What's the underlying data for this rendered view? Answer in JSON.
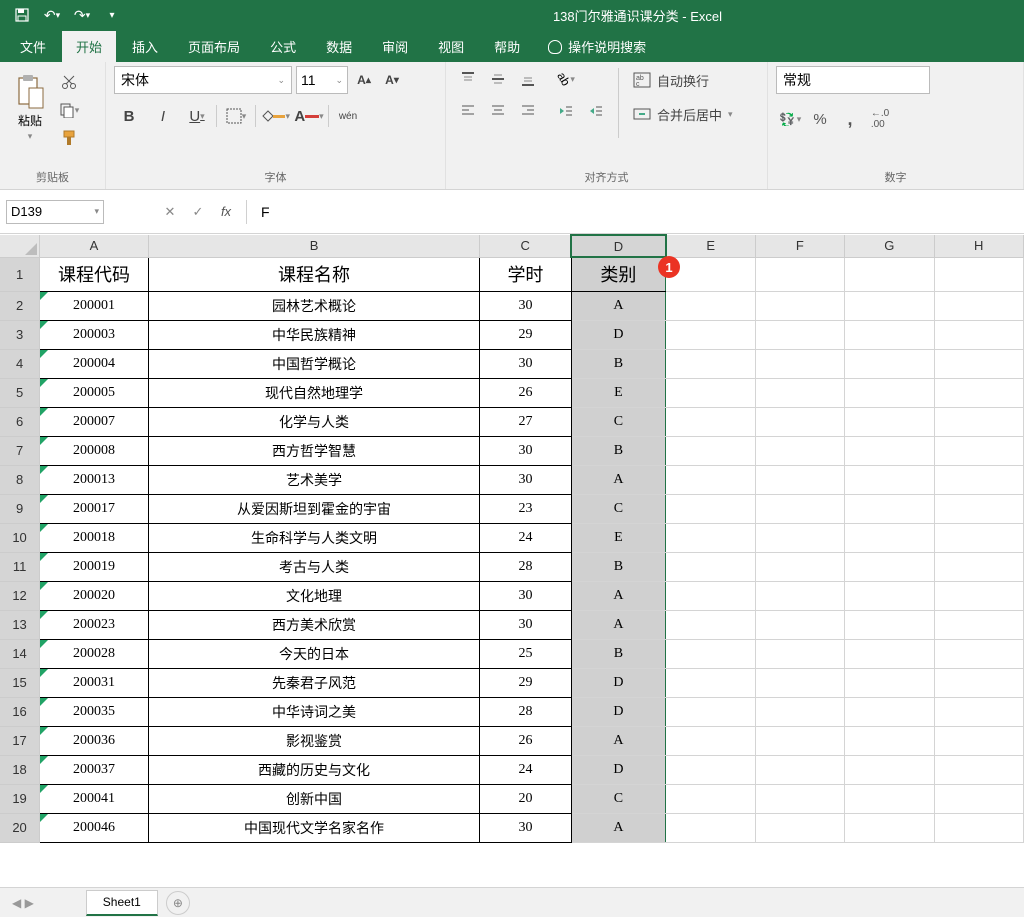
{
  "window": {
    "title": "138门尔雅通识课分类 - Excel"
  },
  "ribbon": {
    "tabs": [
      "文件",
      "开始",
      "插入",
      "页面布局",
      "公式",
      "数据",
      "审阅",
      "视图",
      "帮助"
    ],
    "tell_me": "操作说明搜索",
    "groups": {
      "clipboard": {
        "label": "剪贴板",
        "paste": "粘贴"
      },
      "font": {
        "label": "字体",
        "name": "宋体",
        "size": "11",
        "bold": "B",
        "italic": "I",
        "underline": "U",
        "wen": "wén"
      },
      "alignment": {
        "label": "对齐方式",
        "wrap": "自动换行",
        "merge": "合并后居中"
      },
      "number": {
        "label": "数字",
        "format": "常规"
      }
    }
  },
  "name_box": "D139",
  "formula_value": "F",
  "columns": [
    "A",
    "B",
    "C",
    "D",
    "E",
    "F",
    "G",
    "H"
  ],
  "headers": [
    "课程代码",
    "课程名称",
    "学时",
    "类别"
  ],
  "rows": [
    {
      "n": 2,
      "a": "200001",
      "b": "园林艺术概论",
      "c": "30",
      "d": "A"
    },
    {
      "n": 3,
      "a": "200003",
      "b": "中华民族精神",
      "c": "29",
      "d": "D"
    },
    {
      "n": 4,
      "a": "200004",
      "b": "中国哲学概论",
      "c": "30",
      "d": "B"
    },
    {
      "n": 5,
      "a": "200005",
      "b": "现代自然地理学",
      "c": "26",
      "d": "E"
    },
    {
      "n": 6,
      "a": "200007",
      "b": "化学与人类",
      "c": "27",
      "d": "C"
    },
    {
      "n": 7,
      "a": "200008",
      "b": "西方哲学智慧",
      "c": "30",
      "d": "B"
    },
    {
      "n": 8,
      "a": "200013",
      "b": "艺术美学",
      "c": "30",
      "d": "A"
    },
    {
      "n": 9,
      "a": "200017",
      "b": "从爱因斯坦到霍金的宇宙",
      "c": "23",
      "d": "C"
    },
    {
      "n": 10,
      "a": "200018",
      "b": "生命科学与人类文明",
      "c": "24",
      "d": "E"
    },
    {
      "n": 11,
      "a": "200019",
      "b": "考古与人类",
      "c": "28",
      "d": "B"
    },
    {
      "n": 12,
      "a": "200020",
      "b": "文化地理",
      "c": "30",
      "d": "A"
    },
    {
      "n": 13,
      "a": "200023",
      "b": "西方美术欣赏",
      "c": "30",
      "d": "A"
    },
    {
      "n": 14,
      "a": "200028",
      "b": "今天的日本",
      "c": "25",
      "d": "B"
    },
    {
      "n": 15,
      "a": "200031",
      "b": "先秦君子风范",
      "c": "29",
      "d": "D"
    },
    {
      "n": 16,
      "a": "200035",
      "b": "中华诗词之美",
      "c": "28",
      "d": "D"
    },
    {
      "n": 17,
      "a": "200036",
      "b": "影视鉴赏",
      "c": "26",
      "d": "A"
    },
    {
      "n": 18,
      "a": "200037",
      "b": "西藏的历史与文化",
      "c": "24",
      "d": "D"
    },
    {
      "n": 19,
      "a": "200041",
      "b": "创新中国",
      "c": "20",
      "d": "C"
    },
    {
      "n": 20,
      "a": "200046",
      "b": "中国现代文学名家名作",
      "c": "30",
      "d": "A"
    }
  ],
  "sheet": {
    "name": "Sheet1"
  },
  "annotation": "1"
}
